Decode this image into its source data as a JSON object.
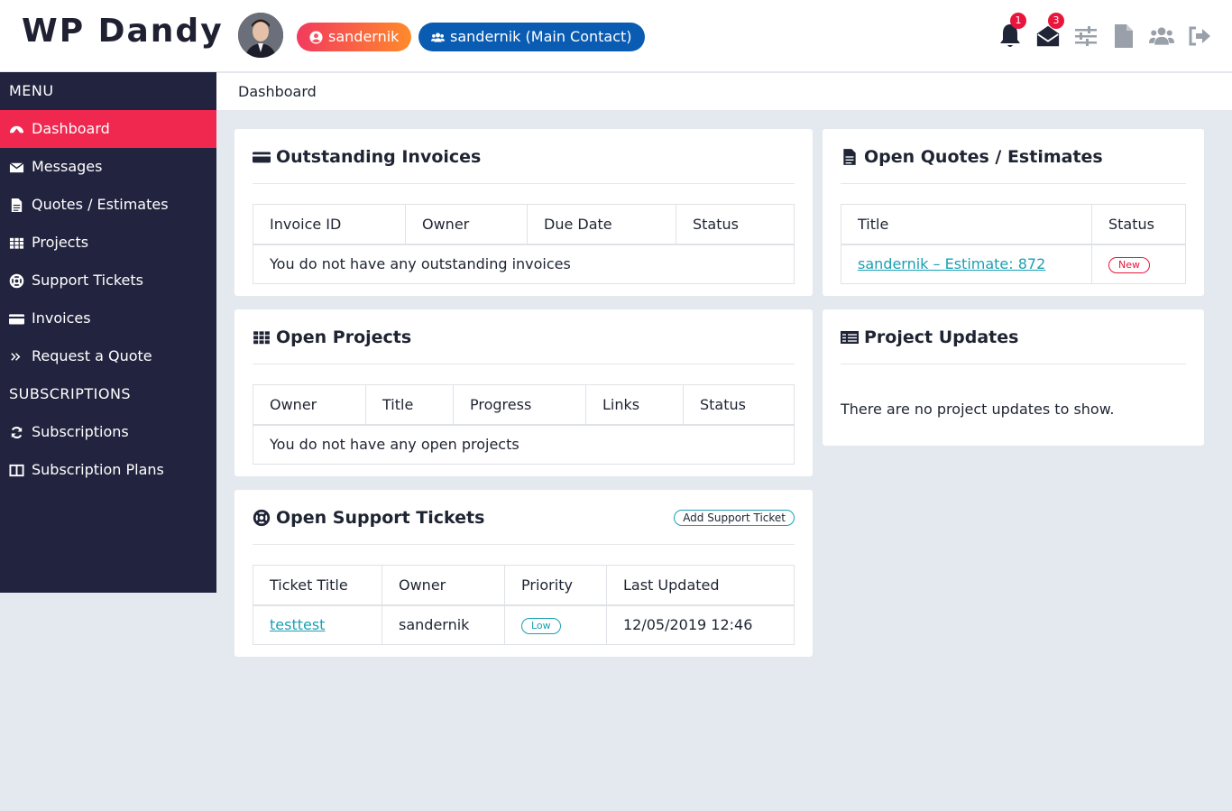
{
  "header": {
    "logo": "WP Dandy",
    "user_label": "sandernik",
    "contact_label": "sandernik  (Main Contact)",
    "notifications_count": "1",
    "messages_count": "3"
  },
  "sidebar": {
    "menu_heading": "MENU",
    "items": [
      {
        "label": "Dashboard"
      },
      {
        "label": "Messages"
      },
      {
        "label": "Quotes / Estimates"
      },
      {
        "label": "Projects"
      },
      {
        "label": "Support Tickets"
      },
      {
        "label": "Invoices"
      },
      {
        "label": "Request a Quote"
      }
    ],
    "subscriptions_heading": "SUBSCRIPTIONS",
    "sub_items": [
      {
        "label": "Subscriptions"
      },
      {
        "label": "Subscription Plans"
      }
    ]
  },
  "breadcrumb": "Dashboard",
  "invoices": {
    "title": "Outstanding Invoices",
    "columns": [
      "Invoice ID",
      "Owner",
      "Due Date",
      "Status"
    ],
    "empty": "You do not have any outstanding invoices"
  },
  "projects": {
    "title": "Open Projects",
    "columns": [
      "Owner",
      "Title",
      "Progress",
      "Links",
      "Status"
    ],
    "empty": "You do not have any open projects"
  },
  "tickets": {
    "title": "Open Support Tickets",
    "add_button": "Add Support Ticket",
    "columns": [
      "Ticket Title",
      "Owner",
      "Priority",
      "Last Updated"
    ],
    "rows": [
      {
        "title": "testtest",
        "owner": "sandernik",
        "priority": "Low",
        "updated": "12/05/2019 12:46"
      }
    ]
  },
  "quotes": {
    "title": "Open Quotes / Estimates",
    "columns": [
      "Title",
      "Status"
    ],
    "rows": [
      {
        "title": "sandernik – Estimate: 872",
        "status": "New"
      }
    ]
  },
  "updates": {
    "title": "Project Updates",
    "empty": "There are no project updates to show."
  },
  "colors": {
    "sidebar_bg": "#22243f",
    "active": "#f0284f",
    "accent_link": "#1aa0b5",
    "contact_pill": "#0a5cb3"
  }
}
